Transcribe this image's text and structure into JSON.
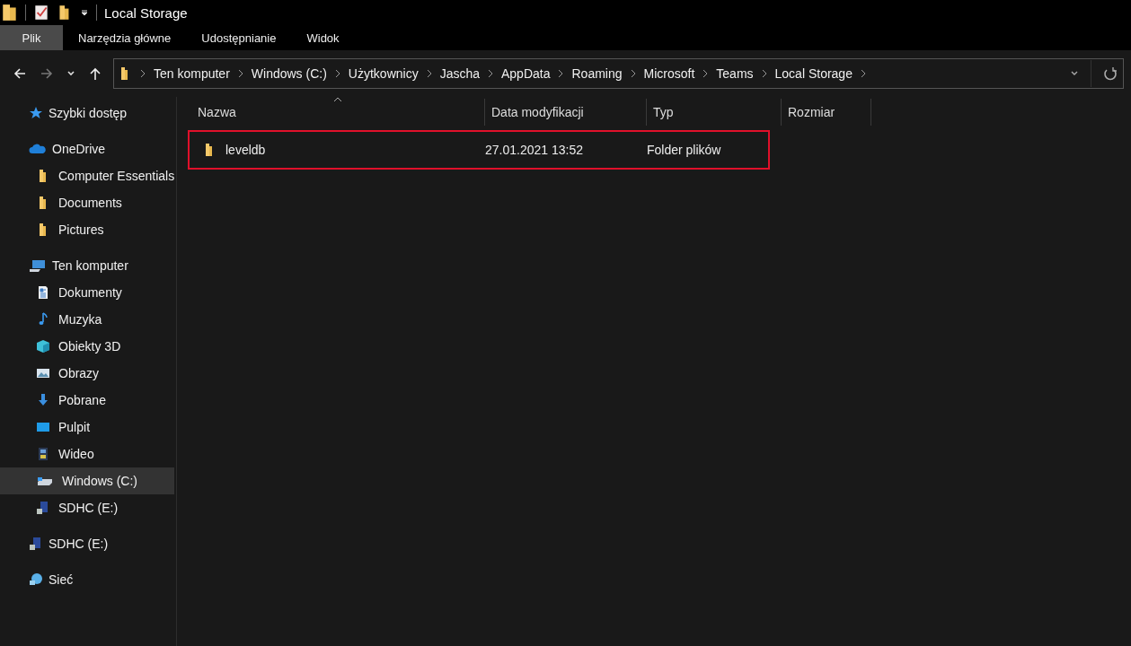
{
  "window": {
    "title": "Local Storage"
  },
  "ribbon_tabs": [
    {
      "label": "Plik",
      "selected": true
    },
    {
      "label": "Narzędzia główne",
      "selected": false
    },
    {
      "label": "Udostępnianie",
      "selected": false
    },
    {
      "label": "Widok",
      "selected": false
    }
  ],
  "address_bar": {
    "path": [
      "Ten komputer",
      "Windows (C:)",
      "Użytkownicy",
      "Jascha",
      "AppData",
      "Roaming",
      "Microsoft",
      "Teams",
      "Local Storage"
    ]
  },
  "sidebar": {
    "items": [
      {
        "label": "Szybki dostęp",
        "kind": "star",
        "selected": false
      },
      {
        "label": "OneDrive",
        "kind": "cloud",
        "selected": false,
        "children": [
          {
            "label": "Computer Essentials",
            "kind": "folder",
            "selected": false
          },
          {
            "label": "Documents",
            "kind": "folder",
            "selected": false
          },
          {
            "label": "Pictures",
            "kind": "folder",
            "selected": false
          }
        ]
      },
      {
        "label": "Ten komputer",
        "kind": "computer",
        "selected": false,
        "children": [
          {
            "label": "Dokumenty",
            "kind": "document",
            "selected": false
          },
          {
            "label": "Muzyka",
            "kind": "music",
            "selected": false
          },
          {
            "label": "Obiekty 3D",
            "kind": "cube",
            "selected": false
          },
          {
            "label": "Obrazy",
            "kind": "picture",
            "selected": false
          },
          {
            "label": "Pobrane",
            "kind": "download",
            "selected": false
          },
          {
            "label": "Pulpit",
            "kind": "desktop",
            "selected": false
          },
          {
            "label": "Wideo",
            "kind": "video",
            "selected": false
          },
          {
            "label": "Windows (C:)",
            "kind": "drive",
            "selected": true
          },
          {
            "label": "SDHC (E:)",
            "kind": "sdcard",
            "selected": false
          }
        ]
      },
      {
        "label": "SDHC (E:)",
        "kind": "sdcard",
        "selected": false
      },
      {
        "label": "Sieć",
        "kind": "network",
        "selected": false
      }
    ]
  },
  "file_list": {
    "columns": [
      {
        "label": "Nazwa",
        "sorted": true
      },
      {
        "label": "Data modyfikacji",
        "sorted": false
      },
      {
        "label": "Typ",
        "sorted": false
      },
      {
        "label": "Rozmiar",
        "sorted": false
      }
    ],
    "rows": [
      {
        "name": "leveldb",
        "modified": "27.01.2021 13:52",
        "type": "Folder plików",
        "highlighted": true
      }
    ]
  }
}
